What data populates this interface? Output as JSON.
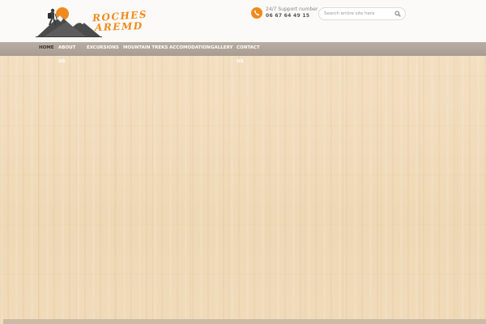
{
  "header": {
    "logo": {
      "line1": "ROCHES",
      "line2": "AREMD",
      "icon": "hiker-mountain-logo-icon"
    },
    "support": {
      "icon": "phone-icon",
      "label": "24/7 Support number",
      "number": "06 67 64 49 15"
    },
    "search": {
      "placeholder": "Search entire site here",
      "icon": "search-icon"
    }
  },
  "nav": {
    "items": [
      {
        "label": "HOME",
        "active": true
      },
      {
        "label": "ABOUT",
        "sub": "US"
      },
      {
        "label": "EXCURSIONS"
      },
      {
        "label": "MOUNTAIN TREKS"
      },
      {
        "label": "ACCOMODATION"
      },
      {
        "label": "GALLERY"
      },
      {
        "label": "CONTACT",
        "sub": "US"
      }
    ]
  },
  "colors": {
    "brand_orange": "#f08a1e",
    "nav_bg": "#afa399",
    "wood": "#f1dcbc",
    "logo_dark": "#4a4a4a"
  }
}
